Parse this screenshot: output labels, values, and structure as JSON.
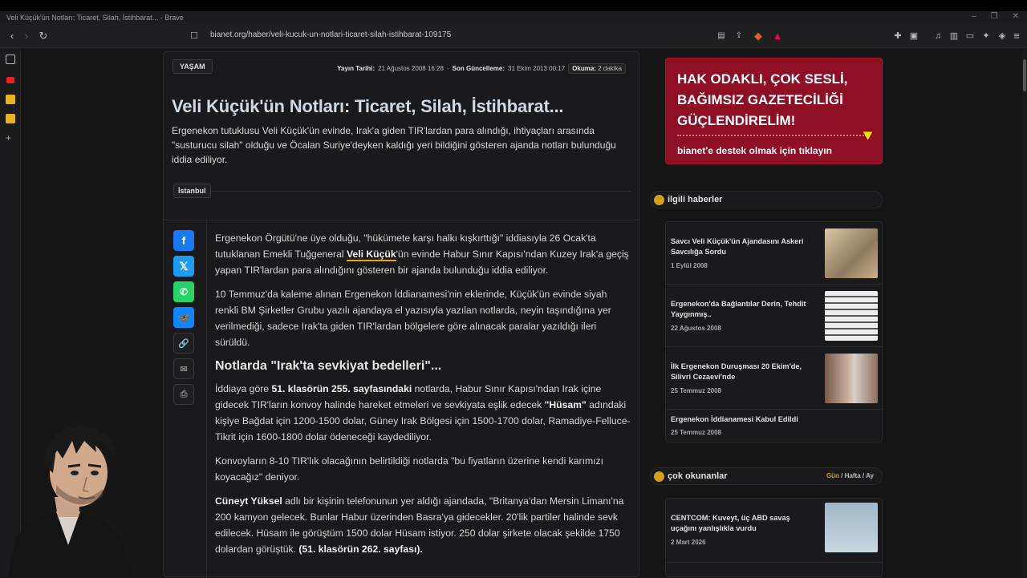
{
  "window": {
    "title": "Veli Küçük'ün Notları: Ticaret, Silah, İstihbarat... - Brave"
  },
  "address_bar": {
    "url": "bianet.org/haber/veli-kucuk-un-notlari-ticaret-silah-istihbarat-109175"
  },
  "article": {
    "category": "YAŞAM",
    "meta": {
      "published_label": "Yayın Tarihi:",
      "published": "21 Ağustos 2008 16:28",
      "updated_label": "Son Güncelleme:",
      "updated": "31 Ekim 2013 00:17",
      "read_label": "Okuma:",
      "read": "2 dakika"
    },
    "title": "Veli Küçük'ün Notları: Ticaret, Silah, İstihbarat...",
    "lead": "Ergenekon tutuklusu Veli Küçük'ün evinde, Irak'a giden TIR'lardan para alındığı, ihtiyaçları arasında \"susturucu silah\" olduğu ve Öcalan Suriye'deyken kaldığı yeri bildiğini gösteren ajanda notları bulunduğu iddia ediliyor.",
    "location": "İstanbul",
    "p1_a": "Ergenekon Örgütü'ne üye olduğu, \"hükümete karşı halkı kışkırttığı\" iddiasıyla 26 Ocak'ta tutuklanan Emekli Tuğgeneral ",
    "p1_link": "Veli Küçük",
    "p1_b": "'ün evinde Habur Sınır Kapısı'ndan Kuzey Irak'a geçiş yapan TIR'lardan para alındığını gösteren bir ajanda bulunduğu iddia ediliyor.",
    "p2": "10 Temmuz'da kaleme alınan Ergenekon İddianamesi'nin eklerinde, Küçük'ün evinde siyah renkli BM Şirketler Grubu yazılı ajandaya el yazısıyla yazılan notlarda, neyin taşındığına yer verilmediği, sadece Irak'ta giden TIR'lardan bölgelere göre alınacak paralar yazıldığı ileri sürüldü.",
    "h2": "Notlarda \"Irak'ta sevkiyat bedelleri\"...",
    "p3_a": "İddiaya göre ",
    "p3_b": "51. klasörün 255. sayfasındaki",
    "p3_c": " notlarda, Habur Sınır Kapısı'ndan Irak içine gidecek TIR'ların konvoy halinde hareket etmeleri ve sevkiyata eşlik edecek ",
    "p3_d": "\"Hüsam\"",
    "p3_e": " adındaki kişiye Bağdat için 1200-1500 dolar, Güney Irak Bölgesi için 1500-1700 dolar, Ramadiye-Felluce-Tikrit için 1600-1800 dolar ödeneceği kaydediliyor.",
    "p4": "Konvoyların 8-10 TIR'lık olacağının belirtildiği notlarda \"bu fiyatların üzerine kendi karımızı koyacağız\" deniyor.",
    "p5_a": "Cüneyt Yüksel",
    "p5_b": " adlı bir kişinin telefonunun yer aldığı ajandada, \"Britanya'dan Mersin Limanı'na 200 kamyon gelecek. Bunlar Habur üzerinden Basra'ya gidecekler. 20'lik partiler halinde sevk edilecek. Hüsam ile görüştüm 1500 dolar Hüsam istiyor. 250 dolar şirkete olacak şekilde 1750 dolardan görüştük. ",
    "p5_c": "(51. klasörün 262. sayfası)."
  },
  "ad": {
    "headline": "HAK ODAKLI, ÇOK SESLİ, BAĞIMSIZ GAZETECİLİĞİ GÜÇLENDİRELİM!",
    "cta": "bianet'e destek olmak için tıklayın"
  },
  "related": {
    "title": "ilgili haberler",
    "items": [
      {
        "title": "Savcı Veli Küçük'ün Ajandasını Askeri Savcılığa Sordu",
        "date": "1 Eylül 2008"
      },
      {
        "title": "Ergenekon'da Bağlantılar Derin, Tehdit Yaygınmış..",
        "date": "22 Ağustos 2008"
      },
      {
        "title": "İlk Ergenekon Duruşması 20 Ekim'de, Silivri Cezaevi'nde",
        "date": "25 Temmuz 2008"
      },
      {
        "title": "Ergenekon İddianamesi Kabul Edildi",
        "date": "25 Temmuz 2008"
      }
    ]
  },
  "popular": {
    "title": "çok okunanlar",
    "tab_day": "Gün",
    "tab_week": "Hafta",
    "tab_month": "Ay",
    "sep": "/",
    "items": [
      {
        "title": "CENTCOM: Kuveyt, üç ABD savaş uçağını yanlışlıkla vurdu",
        "date": "2 Mart 2026"
      }
    ]
  },
  "colors": {
    "accent": "#d4a017",
    "ad_bg": "#8e0f24",
    "facebook": "#1877f2",
    "x": "#1d9bf0",
    "whatsapp": "#25d366",
    "bluesky": "#1185fe"
  },
  "icons": [
    "back-icon",
    "forward-icon",
    "reload-icon",
    "bookmark-icon",
    "facebook-icon",
    "x-icon",
    "whatsapp-icon",
    "bluesky-icon",
    "link-icon",
    "mail-icon",
    "print-icon"
  ]
}
